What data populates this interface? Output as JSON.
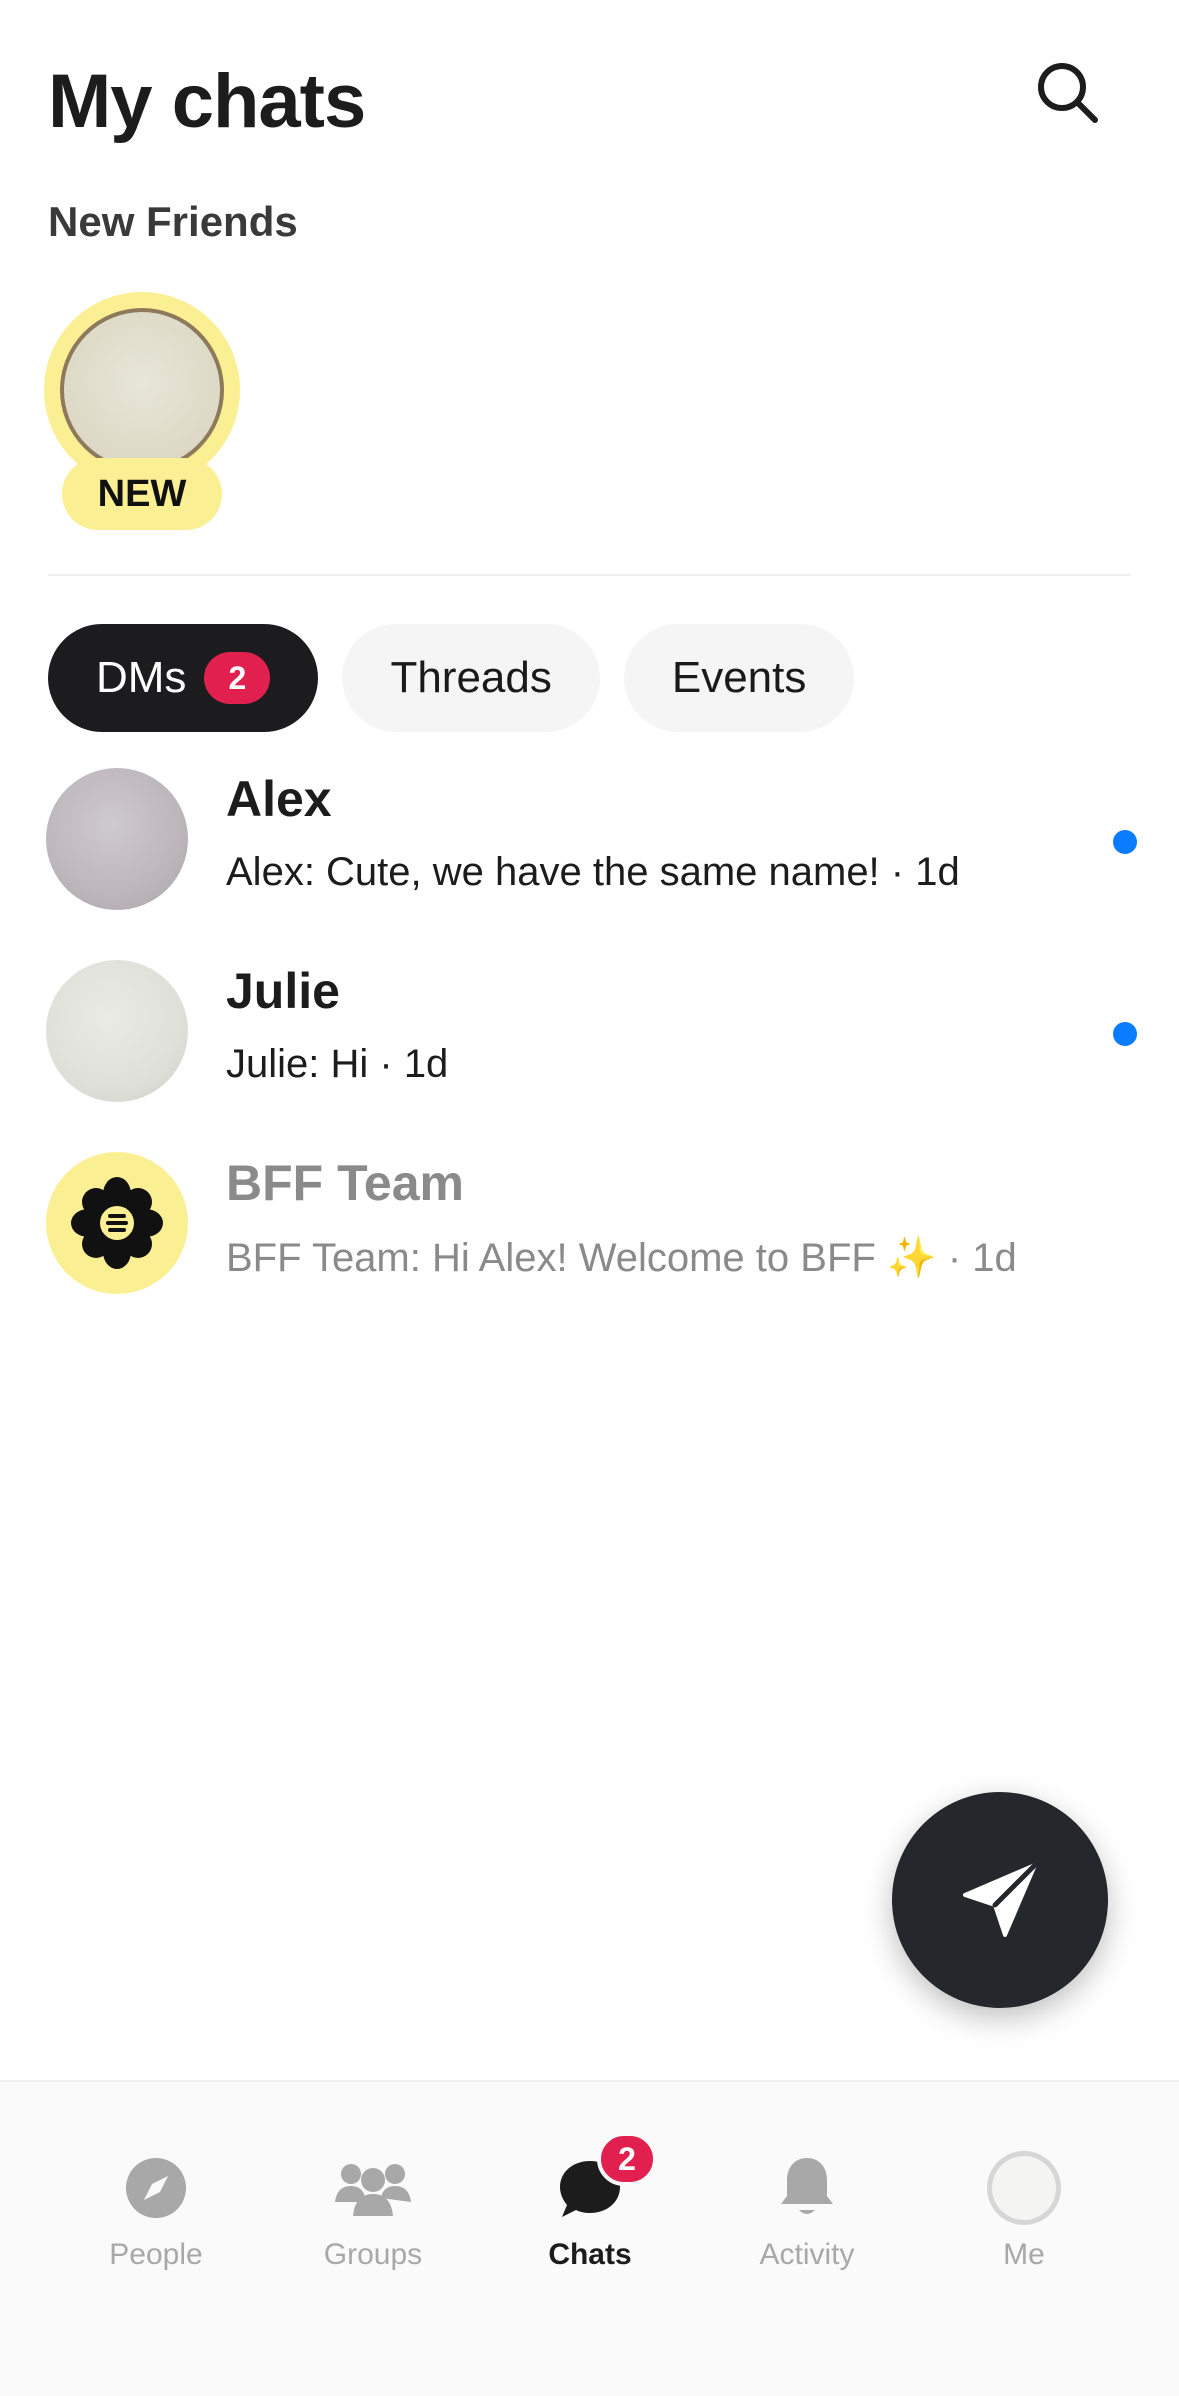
{
  "header": {
    "title": "My chats",
    "search_icon": "search-icon"
  },
  "new_friends": {
    "label": "New Friends",
    "items": [
      {
        "badge": "NEW"
      }
    ]
  },
  "tabs": [
    {
      "label": "DMs",
      "badge": "2",
      "active": true
    },
    {
      "label": "Threads",
      "active": false
    },
    {
      "label": "Events",
      "active": false
    }
  ],
  "chats": [
    {
      "name": "Alex",
      "preview": "Alex: Cute, we have the same name! · 1d",
      "unread": true
    },
    {
      "name": "Julie",
      "preview": "Julie: Hi  · 1d",
      "unread": true
    },
    {
      "name": "BFF Team",
      "preview": "BFF Team: Hi Alex! Welcome to BFF ✨ · 1d",
      "unread": false
    }
  ],
  "fab": {
    "icon": "send-icon"
  },
  "bottom_nav": [
    {
      "label": "People",
      "icon": "compass-icon",
      "active": false
    },
    {
      "label": "Groups",
      "icon": "group-icon",
      "active": false
    },
    {
      "label": "Chats",
      "icon": "chat-bubble-icon",
      "active": true,
      "badge": "2"
    },
    {
      "label": "Activity",
      "icon": "bell-icon",
      "active": false
    },
    {
      "label": "Me",
      "icon": "profile-avatar",
      "active": false
    }
  ],
  "colors": {
    "accent_badge": "#e2204f",
    "unread_dot": "#0a7cff",
    "highlight_yellow": "#fbef93",
    "dark": "#1c1c1e"
  }
}
